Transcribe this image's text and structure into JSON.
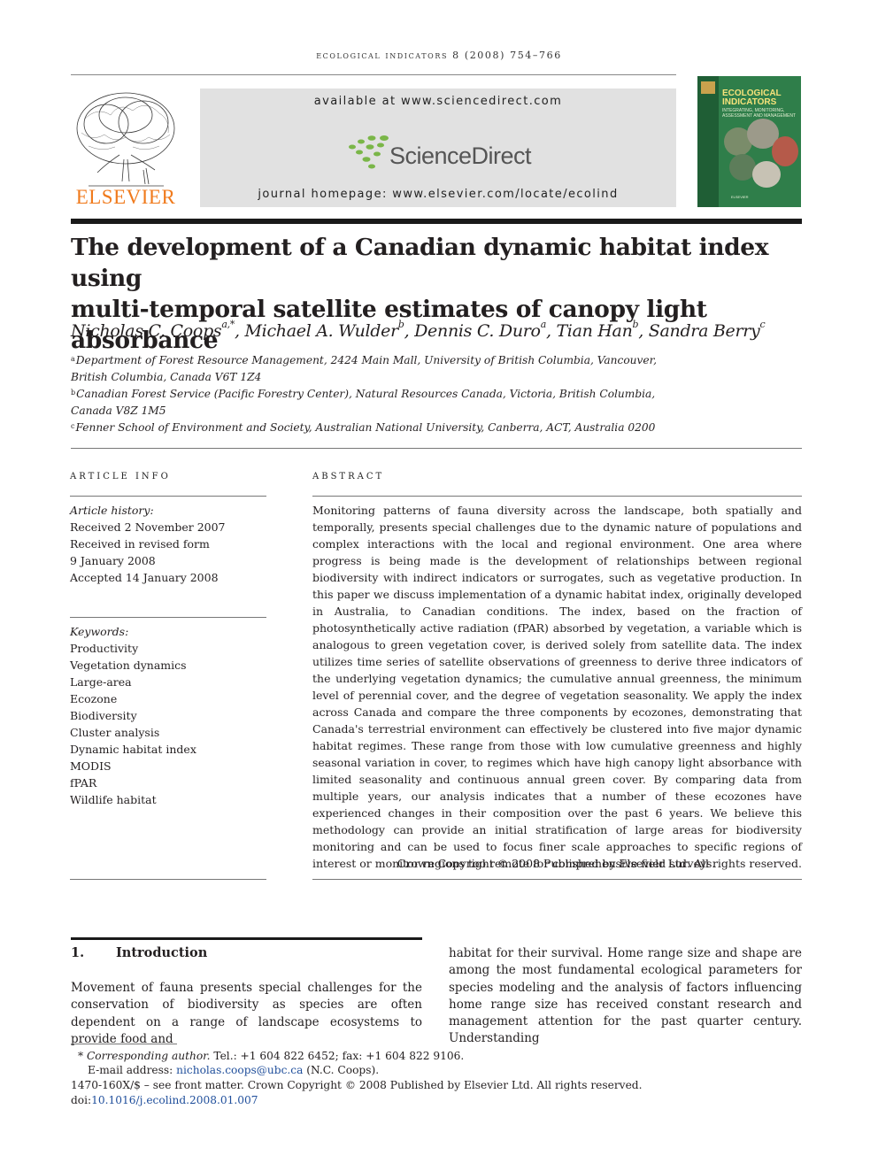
{
  "header": {
    "journal_citation": "ecological indicators 8 (2008) 754–766",
    "publisher_wordmark": "ELSEVIER",
    "available_at": "available at www.sciencedirect.com",
    "sciencedirect_name": "ScienceDirect",
    "journal_homepage": "journal homepage: www.elsevier.com/locate/ecolind",
    "cover": {
      "title_line1": "ECOLOGICAL",
      "title_line2": "INDICATORS",
      "subtitle": "INTEGRATING, MONITORING, ASSESSMENT AND MANAGEMENT",
      "footer": "ELSEVIER"
    }
  },
  "article": {
    "title_line1": "The development of a Canadian dynamic habitat index using",
    "title_line2": "multi-temporal satellite estimates of canopy light absorbance",
    "authors": [
      {
        "name": "Nicholas C. Coops",
        "sup": "a,*",
        "sep": ", "
      },
      {
        "name": "Michael A. Wulder",
        "sup": "b",
        "sep": ", "
      },
      {
        "name": "Dennis C. Duro",
        "sup": "a",
        "sep": ", "
      },
      {
        "name": "Tian Han",
        "sup": "b",
        "sep": ", "
      },
      {
        "name": "Sandra Berry",
        "sup": "c",
        "sep": ""
      }
    ],
    "affiliations": [
      {
        "key": "a",
        "line1": "Department of Forest Resource Management, 2424 Main Mall, University of British Columbia, Vancouver,",
        "line2": "British Columbia, Canada V6T 1Z4"
      },
      {
        "key": "b",
        "line1": "Canadian Forest Service (Pacific Forestry Center), Natural Resources Canada, Victoria, British Columbia,",
        "line2": "Canada V8Z 1M5"
      },
      {
        "key": "c",
        "line1": "Fenner School of Environment and Society, Australian National University, Canberra, ACT, Australia 0200",
        "line2": ""
      }
    ]
  },
  "article_info": {
    "heading": "article info",
    "history_label": "Article history:",
    "history": [
      "Received 2 November 2007",
      "Received in revised form",
      "9 January 2008",
      "Accepted 14 January 2008"
    ],
    "keywords_label": "Keywords:",
    "keywords": [
      "Productivity",
      "Vegetation dynamics",
      "Large-area",
      "Ecozone",
      "Biodiversity",
      "Cluster analysis",
      "Dynamic habitat index",
      "MODIS",
      "fPAR",
      "Wildlife habitat"
    ]
  },
  "abstract": {
    "heading": "abstract",
    "text": "Monitoring patterns of fauna diversity across the landscape, both spatially and temporally, presents special challenges due to the dynamic nature of populations and complex interactions with the local and regional environment. One area where progress is being made is the development of relationships between regional biodiversity with indirect indicators or surrogates, such as vegetative production. In this paper we discuss implementation of a dynamic habitat index, originally developed in Australia, to Canadian conditions. The index, based on the fraction of photosynthetically active radiation (fPAR) absorbed by vegetation, a variable which is analogous to green vegetation cover, is derived solely from satellite data. The index utilizes time series of satellite observations of greenness to derive three indicators of the underlying vegetation dynamics; the cumulative annual greenness, the minimum level of perennial cover, and the degree of vegetation seasonality. We apply the index across Canada and compare the three components by ecozones, demonstrating that Canada's terrestrial environment can effectively be clustered into five major dynamic habitat regimes. These range from those with low cumulative greenness and highly seasonal variation in cover, to regimes which have high canopy light absorbance with limited seasonality and continuous annual green cover. By comparing data from multiple years, our analysis indicates that a number of these ecozones have experienced changes in their composition over the past 6 years. We believe this methodology can provide an initial stratification of large areas for biodiversity monitoring and can be used to focus finer scale approaches to specific regions of interest or monitor regions too remote for comprehensive field surveys.",
    "copyright": "Crown Copyright © 2008 Published by Elsevier Ltd. All rights reserved."
  },
  "introduction": {
    "number": "1.",
    "heading": "Introduction",
    "left_text": "Movement of fauna presents special challenges for the conservation of biodiversity as species are often dependent on a range of landscape ecosystems to provide food and",
    "right_text": "habitat for their survival. Home range size and shape are among the most fundamental ecological parameters for species modeling and the analysis of factors influencing home range size has received constant research and management attention for the past quarter century. Understanding"
  },
  "footnotes": {
    "corresponding_marker": "*",
    "corresponding_label": "Corresponding author.",
    "corresponding_contact": " Tel.: +1 604 822 6452; fax: +1 604 822 9106.",
    "email_label": "E-mail address: ",
    "email": "nicholas.coops@ubc.ca",
    "email_suffix": " (N.C. Coops).",
    "issn_line": "1470-160X/$ – see front matter. Crown Copyright © 2008 Published by Elsevier Ltd. All rights reserved.",
    "doi_prefix": "doi:",
    "doi": "10.1016/j.ecolind.2008.01.007"
  }
}
